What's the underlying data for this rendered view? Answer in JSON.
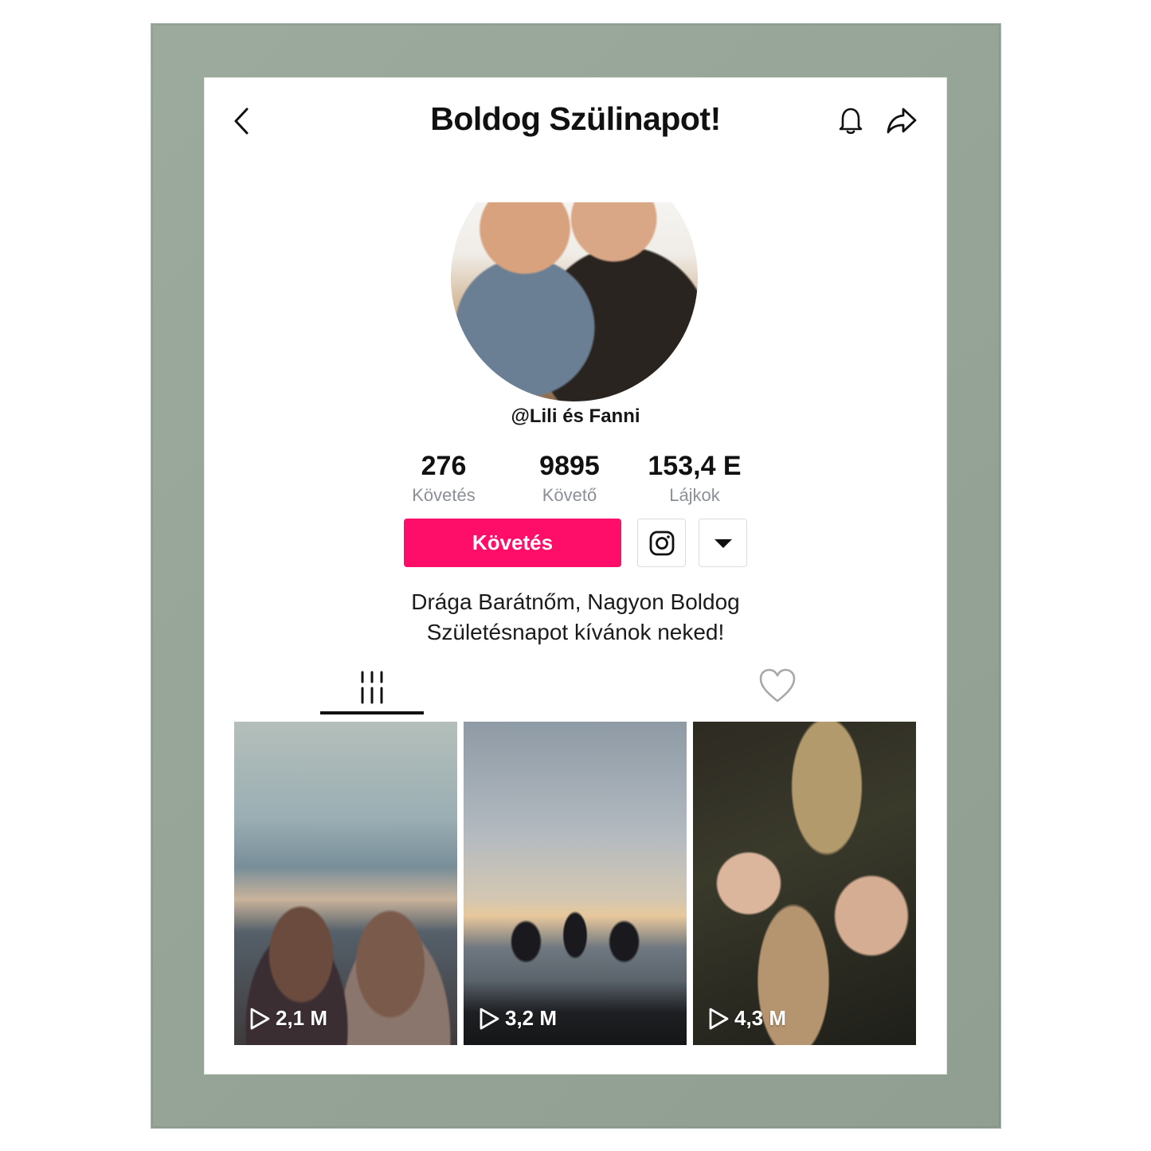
{
  "header": {
    "title": "Boldog Szülinapot!",
    "back_icon": "chevron-left-icon",
    "bell_icon": "bell-icon",
    "share_icon": "share-icon"
  },
  "profile": {
    "username": "@Lili és Fanni",
    "stats": [
      {
        "value": "276",
        "label": "Követés"
      },
      {
        "value": "9895",
        "label": "Követő"
      },
      {
        "value": "153,4 E",
        "label": "Lájkok"
      }
    ],
    "follow_button": "Követés",
    "bio_line1": "Drága Barátnőm, Nagyon Boldog",
    "bio_line2": "Születésnapot kívánok neked!"
  },
  "tabs": {
    "videos_icon": "grid-icon",
    "liked_icon": "heart-icon"
  },
  "videos": [
    {
      "views": "2,1 M"
    },
    {
      "views": "3,2 M"
    },
    {
      "views": "4,3 M"
    }
  ],
  "colors": {
    "accent": "#fe0d69",
    "frame": "#96a598"
  }
}
